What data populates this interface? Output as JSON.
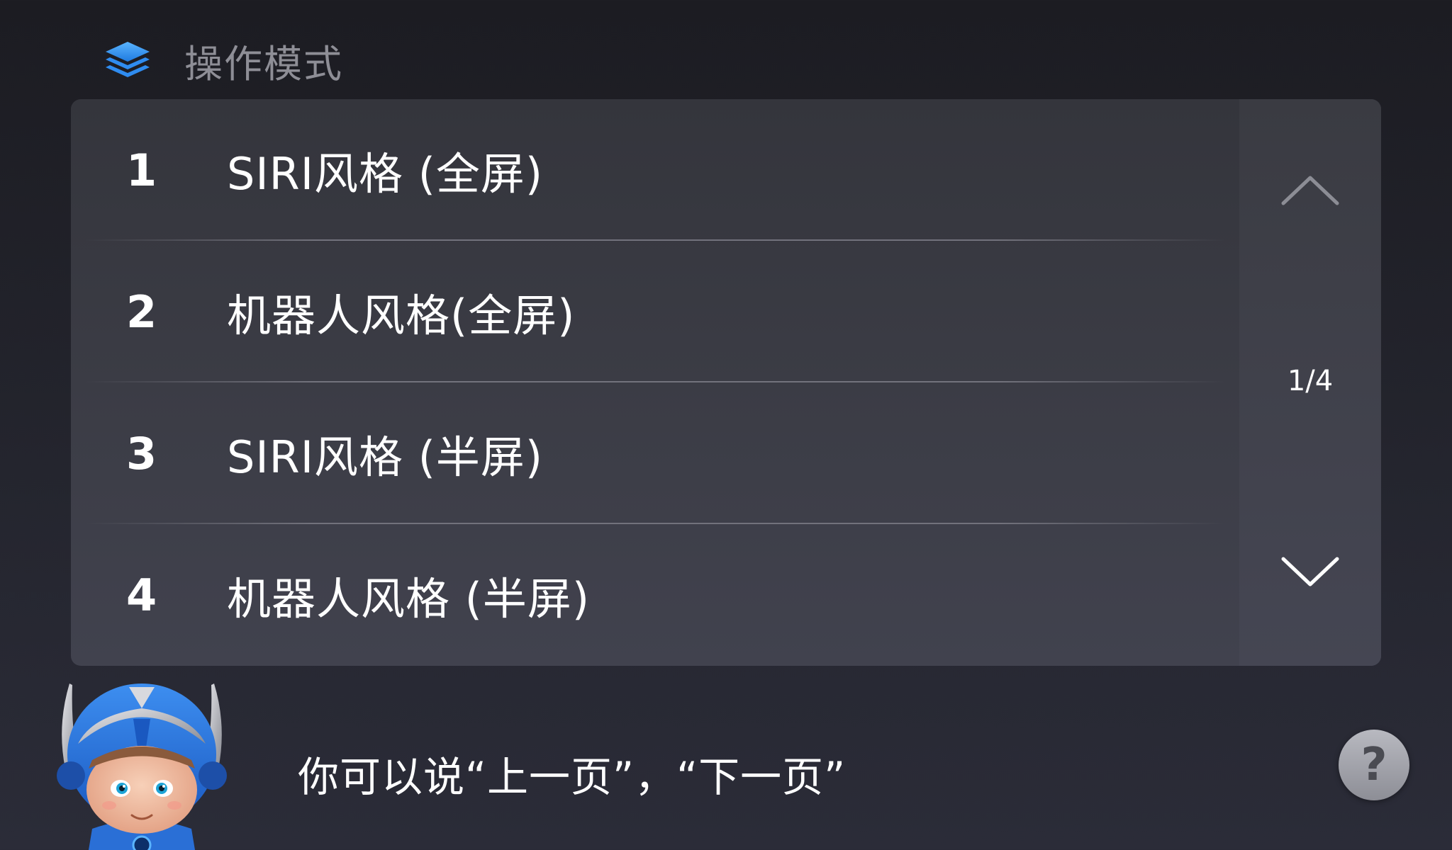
{
  "header": {
    "icon": "layers-icon",
    "title": "操作模式"
  },
  "list": {
    "items": [
      {
        "number": "1",
        "label": "SIRI风格 (全屏)"
      },
      {
        "number": "2",
        "label": "机器人风格(全屏)"
      },
      {
        "number": "3",
        "label": "SIRI风格 (半屏)"
      },
      {
        "number": "4",
        "label": "机器人风格 (半屏)"
      }
    ]
  },
  "pager": {
    "up_icon": "chevron-up-icon",
    "down_icon": "chevron-down-icon",
    "page_indicator": "1/4"
  },
  "assistant": {
    "mascot_icon": "robot-mascot-icon",
    "hint": "你可以说“上一页”，“下一页”",
    "help_label": "?"
  },
  "colors": {
    "accent": "#2f8cf0",
    "background": "#1e1f26",
    "panel": "#3a3b44",
    "title_gray": "#8e8e96"
  }
}
